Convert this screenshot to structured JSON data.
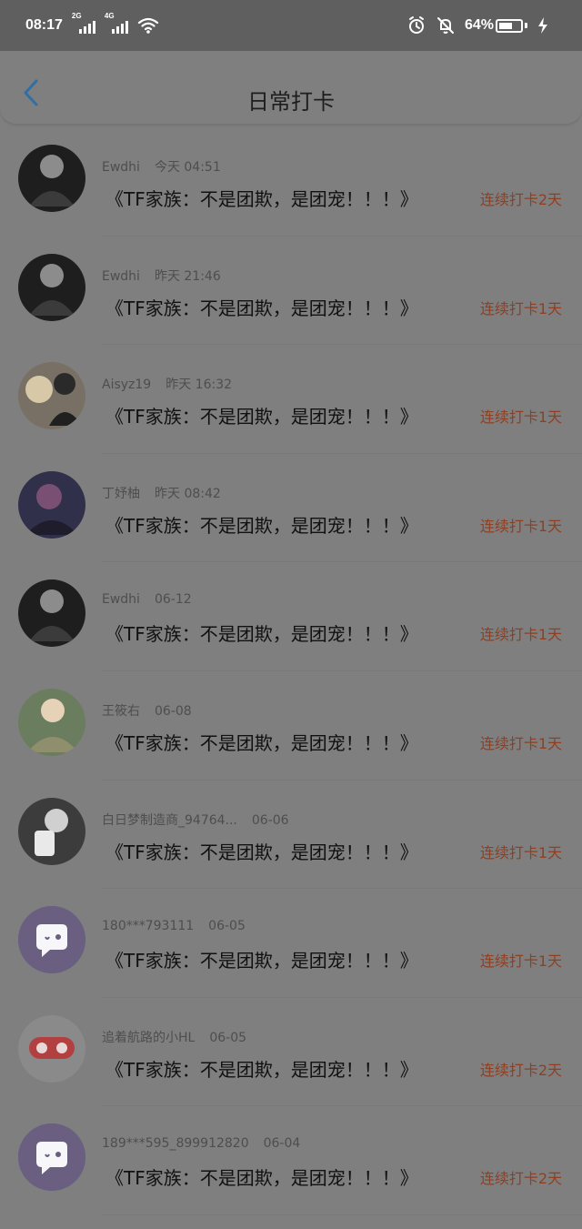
{
  "status_bar": {
    "time": "08:17",
    "signal_1": "2G",
    "signal_2": "4G",
    "battery": "64%"
  },
  "header": {
    "title": "日常打卡",
    "back_icon": "back-arrow-icon"
  },
  "checkins": [
    {
      "name": "Ewdhi",
      "time": "今天 04:51",
      "content": "《TF家族：不是团欺，是团宠！！！》",
      "streak": "连续打卡2天"
    },
    {
      "name": "Ewdhi",
      "time": "昨天 21:46",
      "content": "《TF家族：不是团欺，是团宠！！！》",
      "streak": "连续打卡1天"
    },
    {
      "name": "Aisyz19",
      "time": "昨天 16:32",
      "content": "《TF家族：不是团欺，是团宠！！！》",
      "streak": "连续打卡1天"
    },
    {
      "name": "丁妤柚",
      "time": "昨天 08:42",
      "content": "《TF家族：不是团欺，是团宠！！！》",
      "streak": "连续打卡1天"
    },
    {
      "name": "Ewdhi",
      "time": "06-12",
      "content": "《TF家族：不是团欺，是团宠！！！》",
      "streak": "连续打卡1天"
    },
    {
      "name": "王筱右",
      "time": "06-08",
      "content": "《TF家族：不是团欺，是团宠！！！》",
      "streak": "连续打卡1天"
    },
    {
      "name": "白日梦制造商_94764...",
      "time": "06-06",
      "content": "《TF家族：不是团欺，是团宠！！！》",
      "streak": "连续打卡1天"
    },
    {
      "name": "180***793111",
      "time": "06-05",
      "content": "《TF家族：不是团欺，是团宠！！！》",
      "streak": "连续打卡1天"
    },
    {
      "name": "追着航路的小HL",
      "time": "06-05",
      "content": "《TF家族：不是团欺，是团宠！！！》",
      "streak": "连续打卡2天"
    },
    {
      "name": "189***595_899912820",
      "time": "06-04",
      "content": "《TF家族：不是团欺，是团宠！！！》",
      "streak": "连续打卡2天"
    }
  ],
  "colors": {
    "page_overlay": "#7f7f7f",
    "status_bar": "#5f5f5f",
    "streak": "#8f3f22",
    "back_icon": "#2f6fa5"
  }
}
